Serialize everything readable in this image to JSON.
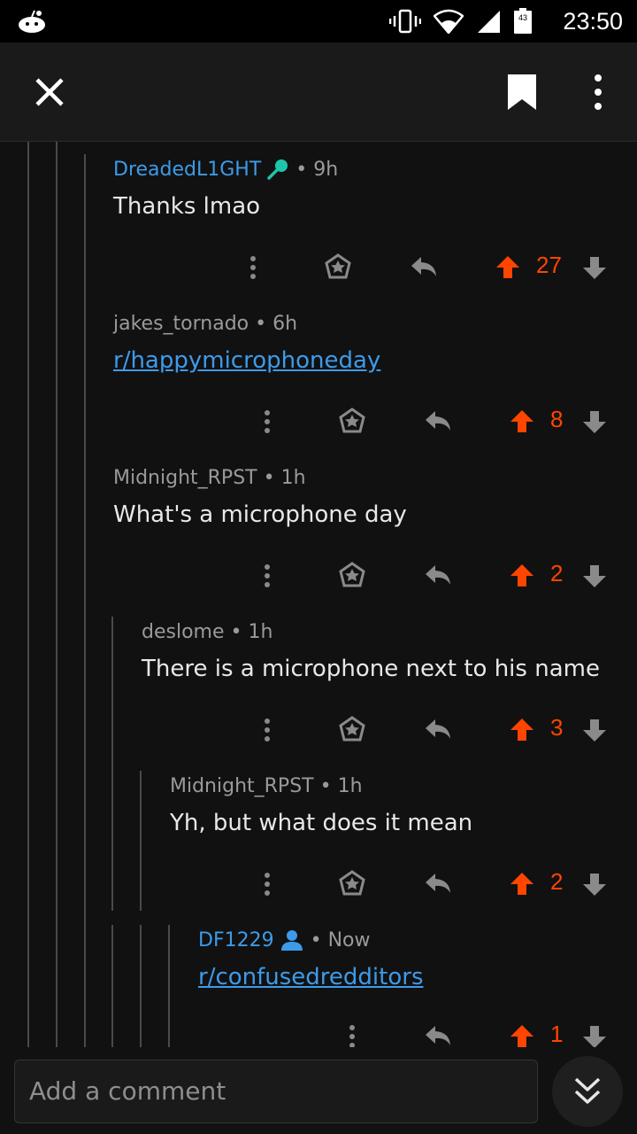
{
  "status_bar": {
    "time": "23:50",
    "battery_level": "43"
  },
  "toolbar": {
    "close_icon": "close-icon",
    "bookmark_icon": "bookmark-icon",
    "more_icon": "more-vertical-icon"
  },
  "comments": [
    {
      "author": "DreadedL1GHT",
      "flair_icon": "microphone-icon",
      "time": "9h",
      "body": "Thanks lmao",
      "score": "27",
      "is_link": false
    },
    {
      "author": "jakes_tornado",
      "time": "6h",
      "body": "r/happymicrophoneday",
      "score": "8",
      "is_link": true
    },
    {
      "author": "Midnight_RPST",
      "time": "1h",
      "body": "What's a microphone day",
      "score": "2",
      "is_link": false
    },
    {
      "author": "deslome",
      "time": "1h",
      "body": "There is a microphone next to his name",
      "score": "3",
      "is_link": false
    },
    {
      "author": "Midnight_RPST",
      "time": "1h",
      "body": "Yh, but what does it mean",
      "score": "2",
      "is_link": false
    },
    {
      "author": "DF1229",
      "flair_icon": "op-user-icon",
      "time": "Now",
      "body": "r/confusedredditors",
      "score": "1",
      "is_link": true
    }
  ],
  "colors": {
    "upvote": "#ff4500",
    "link": "#3d9be9",
    "background": "#111111"
  },
  "composer": {
    "placeholder": "Add a comment"
  }
}
